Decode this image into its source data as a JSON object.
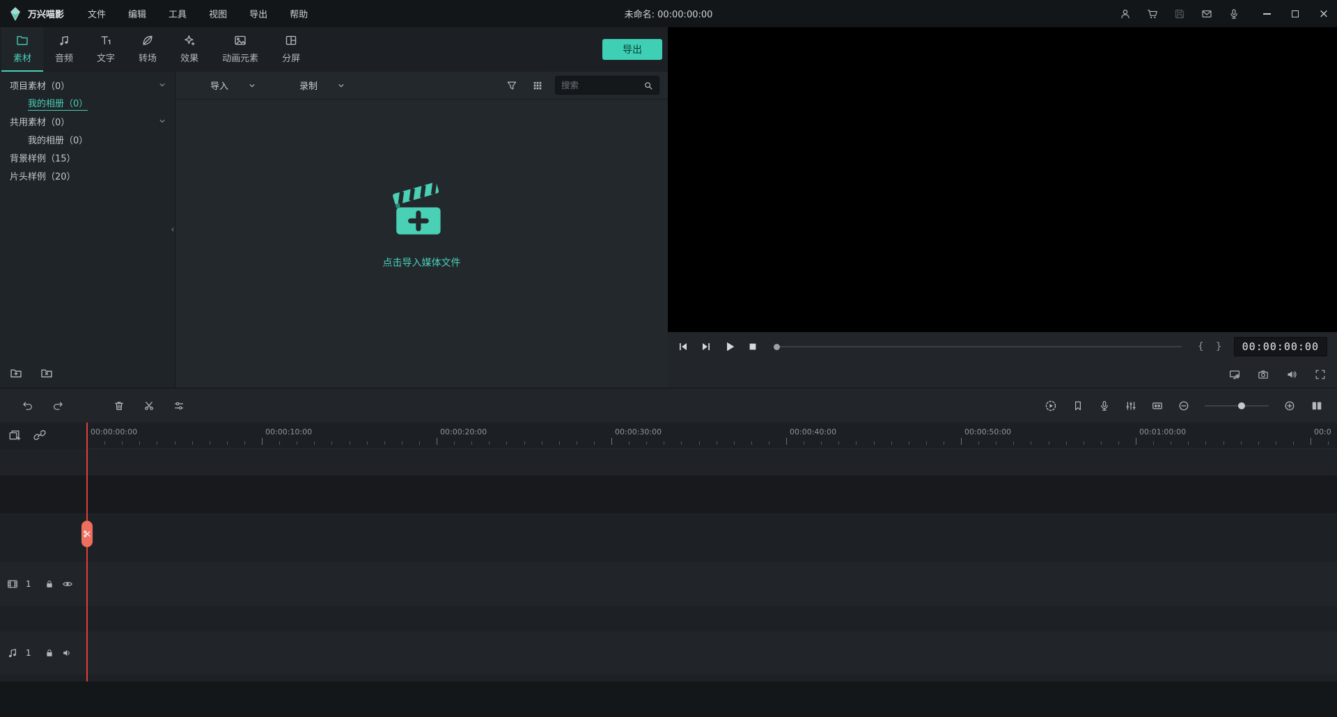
{
  "colors": {
    "accent": "#49d0b5",
    "playhead": "#e03e34",
    "export_button_bg": "#3ecfb4"
  },
  "titlebar": {
    "app_name": "万兴喵影",
    "menus": [
      "文件",
      "编辑",
      "工具",
      "视图",
      "导出",
      "帮助"
    ],
    "project_title": "未命名: 00:00:00:00"
  },
  "tabs": [
    "素材",
    "音频",
    "文字",
    "转场",
    "效果",
    "动画元素",
    "分屏"
  ],
  "export_button": "导出",
  "sidebar": {
    "items": [
      "项目素材（0）",
      "我的相册（0）",
      "共用素材（0）",
      "我的相册（0）",
      "背景样例（15）",
      "片头样例（20）"
    ]
  },
  "media": {
    "import_label": "导入",
    "record_label": "录制",
    "search_placeholder": "搜索",
    "empty_label": "点击导入媒体文件"
  },
  "preview": {
    "mark_in": "{",
    "mark_out": "}",
    "timecode": "00:00:00:00"
  },
  "timeline": {
    "ruler_labels": [
      "00:00:00:00",
      "00:00:10:00",
      "00:00:20:00",
      "00:00:30:00",
      "00:00:40:00",
      "00:00:50:00",
      "00:01:00:00",
      "00:0"
    ],
    "video_track_number": "1",
    "audio_track_number": "1"
  },
  "icons": {
    "titlebar": [
      "app-logo-icon",
      "user-icon",
      "cart-icon",
      "save-icon",
      "mail-icon",
      "mic-icon",
      "minimize-icon",
      "maximize-icon",
      "close-icon"
    ],
    "tabbar": [
      "media-folder-icon",
      "audio-note-icon",
      "text-icon",
      "transition-icon",
      "effects-icon",
      "elements-icon",
      "splitscreen-icon"
    ],
    "media_toolbar": [
      "chevron-down-icon",
      "filter-icon",
      "grid-view-icon",
      "search-icon"
    ],
    "media_area": [
      "clapperboard-icon",
      "add-folder-icon",
      "delete-folder-icon",
      "collapse-sidebar-icon"
    ],
    "preview": [
      "step-back-icon",
      "step-forward-icon",
      "play-icon",
      "stop-icon",
      "display-settings-icon",
      "snapshot-icon",
      "volume-icon",
      "fullscreen-icon"
    ],
    "timeline_toolbar": [
      "undo-icon",
      "redo-icon",
      "delete-icon",
      "split-icon",
      "adjust-icon",
      "render-preview-icon",
      "marker-icon",
      "voiceover-icon",
      "mixer-icon",
      "fit-timeline-icon",
      "zoom-out-icon",
      "zoom-in-icon",
      "dual-pane-icon"
    ],
    "track_headers": [
      "manage-tracks-icon",
      "link-icon",
      "video-track-icon",
      "lock-icon",
      "eye-icon",
      "audio-track-icon",
      "speaker-icon"
    ],
    "playhead": [
      "scissors-icon"
    ]
  }
}
